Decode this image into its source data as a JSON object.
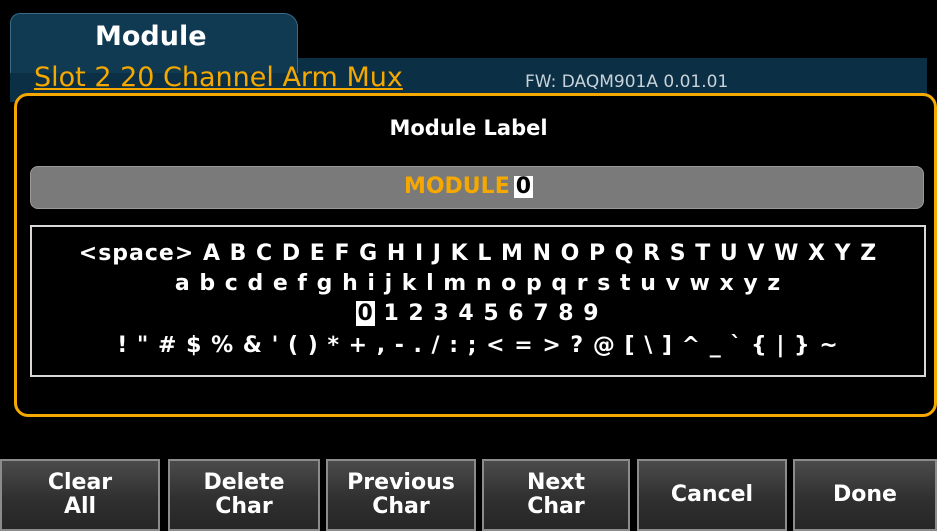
{
  "header": {
    "tab_title": "Module",
    "slot_label": "Slot 2 20 Channel Arm Mux",
    "firmware": "FW: DAQM901A 0.01.01"
  },
  "dialog": {
    "title": "Module Label",
    "input_value": "MODULE",
    "cursor_char": "0"
  },
  "keyboard": {
    "row1": "<space> A B C D E F G H I J K L M N O P Q R S T U V W X Y Z",
    "row2": "a b c d e f g h i j k l m n o p q r s t u v w x y z",
    "row3_selected": "0",
    "row3_rest": " 1 2 3 4 5 6 7 8 9",
    "row4": "! \" # $ % & ' ( ) * + , - . / : ; < = > ? @ [ \\ ] ^ _ ` { | } ~"
  },
  "softkeys": [
    {
      "line1": "Clear",
      "line2": "All"
    },
    {
      "line1": "Delete",
      "line2": "Char"
    },
    {
      "line1": "Previous",
      "line2": "Char"
    },
    {
      "line1": "Next",
      "line2": "Char"
    },
    {
      "line1": "Cancel",
      "line2": ""
    },
    {
      "line1": "Done",
      "line2": ""
    }
  ],
  "colors": {
    "accent": "#f5a800",
    "header_bg": "#0b2f44",
    "input_bg": "#7a7a7a"
  }
}
